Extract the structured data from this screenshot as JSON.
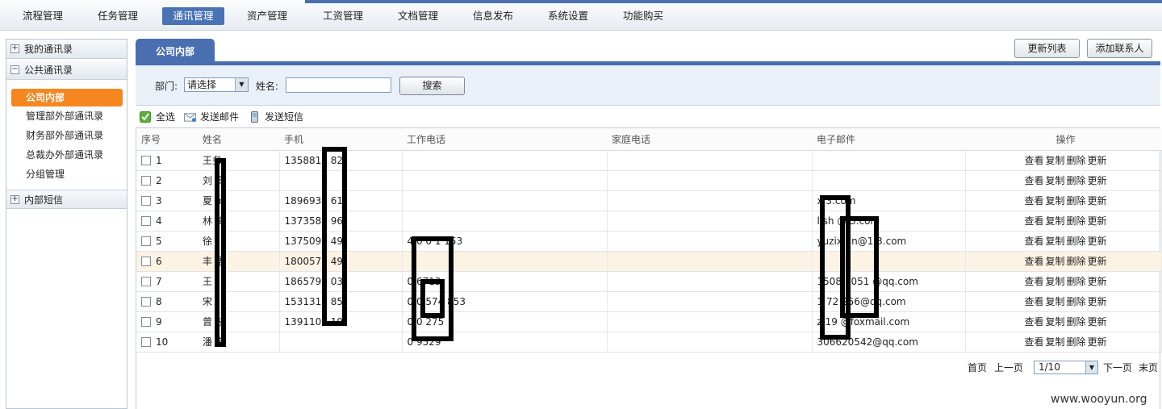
{
  "nav": {
    "items": [
      "流程管理",
      "任务管理",
      "通讯管理",
      "资产管理",
      "工资管理",
      "文档管理",
      "信息发布",
      "系统设置",
      "功能购买"
    ],
    "active_index": 2
  },
  "sidebar": {
    "my_contacts": "我的通讯录",
    "public_contacts": "公共通讯录",
    "company_internal": "公司内部",
    "sub_items": [
      "管理部外部通讯录",
      "财务部外部通讯录",
      "总裁办外部通讯录",
      "分组管理"
    ],
    "internal_sms": "内部短信"
  },
  "tab": {
    "label": "公司内部"
  },
  "actions": {
    "refresh": "更新列表",
    "add_contact": "添加联系人"
  },
  "filter": {
    "dept_label": "部门:",
    "dept_value": "请选择",
    "name_label": "姓名:",
    "name_value": "",
    "search": "搜索"
  },
  "toolbar": {
    "select_all": "全选",
    "send_email": "发送邮件",
    "send_sms": "发送短信"
  },
  "table": {
    "headers": [
      "序号",
      "姓名",
      "手机",
      "工作电话",
      "家庭电话",
      "电子邮件",
      "操作"
    ],
    "rows": [
      {
        "no": "1",
        "name": "王务",
        "mobile": "1358810 82",
        "work": "",
        "home": "",
        "email": ""
      },
      {
        "no": "2",
        "name": "刘 磊",
        "mobile": "",
        "work": "",
        "home": "",
        "email": ""
      },
      {
        "no": "3",
        "name": "夏 m",
        "mobile": "1896935 61",
        "work": "",
        "home": "",
        "email": "x 3.com"
      },
      {
        "no": "4",
        "name": "林 锋",
        "mobile": "1373589 96",
        "work": "",
        "home": "",
        "email": "l sh @ 3.com"
      },
      {
        "no": "5",
        "name": "徐",
        "mobile": "1375092 49",
        "work": "4 0 0 1 153",
        "home": "",
        "email": "yuzix an@1 3.com"
      },
      {
        "no": "6",
        "name": "丰 语",
        "mobile": "1800571 49",
        "work": "",
        "home": "",
        "email": ""
      },
      {
        "no": "7",
        "name": "王",
        "mobile": "1865799 03",
        "work": "0 6713",
        "home": "",
        "email": "1508 1051 @qq.com"
      },
      {
        "no": "8",
        "name": "宋",
        "mobile": "1531317 85",
        "work": "0 0 574 853",
        "home": "",
        "email": "1 72 256@qq.com"
      },
      {
        "no": "9",
        "name": "曾 波",
        "mobile": "1391107 19",
        "work": "0 0 275",
        "home": "",
        "email": "z 19 @foxmail.com"
      },
      {
        "no": "10",
        "name": "潘 海",
        "mobile": "",
        "work": "0 9529",
        "home": "",
        "email": "306620542@qq.com"
      }
    ],
    "ops": [
      "查看",
      "复制",
      "删除",
      "更新"
    ]
  },
  "pager": {
    "first": "首页",
    "prev": "上一页",
    "page": "1/10",
    "next": "下一页",
    "last": "末页"
  },
  "watermark": "www.wooyun.org"
}
